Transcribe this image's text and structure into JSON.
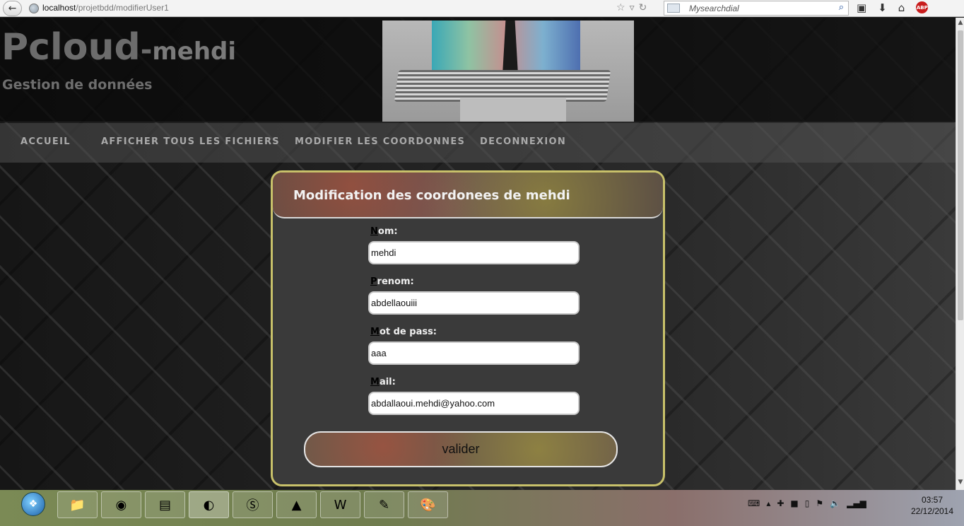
{
  "browser": {
    "url_host": "localhost",
    "url_path": "/projetbdd/modifierUser1",
    "search_placeholder": "Mysearchdial",
    "abp_label": "ABP"
  },
  "site": {
    "title": "Pcloud",
    "title_separator": "-",
    "title_user": "mehdi",
    "subtitle": "Gestion de données"
  },
  "nav": {
    "items": [
      "ACCUEIL",
      "AFFICHER TOUS LES FICHIERS",
      "MODIFIER LES COORDONNES",
      "DECONNEXION"
    ]
  },
  "form": {
    "title": "Modification des coordonees de mehdi",
    "fields": [
      {
        "first": "N",
        "rest": "om:",
        "value": "mehdi"
      },
      {
        "first": "P",
        "rest": "renom:",
        "value": "abdellaouiii"
      },
      {
        "first": "M",
        "rest": "ot de pass:",
        "value": "aaa"
      },
      {
        "first": "M",
        "rest": "ail:",
        "value": "abdallaoui.mehdi@yahoo.com"
      }
    ],
    "submit_label": "valider"
  },
  "taskbar": {
    "apps": [
      "file-explorer-icon",
      "chrome-icon",
      "app-icon",
      "firefox-icon",
      "skype-icon",
      "vlc-icon",
      "word-icon",
      "notepad-icon",
      "paint-icon"
    ],
    "time": "03:57",
    "date": "22/12/2014"
  }
}
